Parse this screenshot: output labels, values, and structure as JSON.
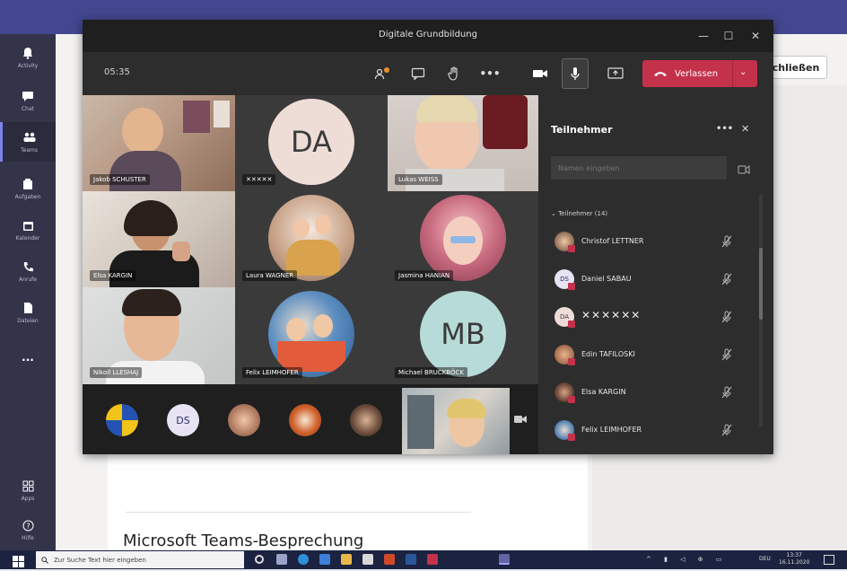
{
  "background_app": {
    "rail": [
      {
        "label": "Activity",
        "icon": "bell-icon"
      },
      {
        "label": "Chat",
        "icon": "chat-icon"
      },
      {
        "label": "Teams",
        "icon": "teams-icon"
      },
      {
        "label": "Aufgaben",
        "icon": "assignments-icon"
      },
      {
        "label": "Kalender",
        "icon": "calendar-icon"
      },
      {
        "label": "Anrufe",
        "icon": "phone-icon"
      },
      {
        "label": "Dateien",
        "icon": "files-icon"
      },
      {
        "label": "...",
        "icon": "more-icon"
      },
      {
        "label": "Apps",
        "icon": "apps-icon"
      },
      {
        "label": "Hilfe",
        "icon": "help-icon"
      }
    ],
    "close_button": "chließen",
    "document_title": "Microsoft Teams-Besprechung"
  },
  "meeting": {
    "title": "Digitale Grundbildung",
    "timer": "05:35",
    "leave_label": "Verlassen",
    "accent_color": "#c4314b",
    "tiles": [
      {
        "name": "Jakob SCHUSTER",
        "type": "video"
      },
      {
        "name": "✕✕✕✕✕",
        "initials": "DA",
        "type": "avatar"
      },
      {
        "name": "Lukas WEISS",
        "type": "video"
      },
      {
        "name": "Elsa KARGIN",
        "type": "video"
      },
      {
        "name": "Laura WAGNER",
        "type": "photo"
      },
      {
        "name": "Jasmina HANIAN",
        "type": "photo"
      },
      {
        "name": "Nikoll LLESHAJ",
        "type": "video"
      },
      {
        "name": "Felix LEIMHOFER",
        "type": "photo"
      },
      {
        "name": "Michael BRUCKBÖCK",
        "initials": "MB",
        "type": "avatar"
      }
    ],
    "strip": [
      {
        "type": "photo"
      },
      {
        "initials": "DS",
        "type": "avatar"
      },
      {
        "type": "photo"
      },
      {
        "type": "photo"
      },
      {
        "type": "photo"
      }
    ]
  },
  "participants": {
    "title": "Teilnehmer",
    "search_placeholder": "Namen eingeben",
    "section": "Teilnehmer (14)",
    "list": [
      {
        "name": "Christof LETTNER",
        "initials": ""
      },
      {
        "name": "Daniel SABAU",
        "initials": "DS"
      },
      {
        "name": "✕✕✕✕✕✕",
        "initials": "DA"
      },
      {
        "name": "Edin TAFILOSKI",
        "initials": ""
      },
      {
        "name": "Elsa KARGIN",
        "initials": ""
      },
      {
        "name": "Felix LEIMHOFER",
        "initials": ""
      }
    ]
  },
  "taskbar": {
    "search_placeholder": "Zur Suche Text hier eingeben",
    "language": "DEU",
    "time": "13:37",
    "date": "16.11.2020"
  }
}
